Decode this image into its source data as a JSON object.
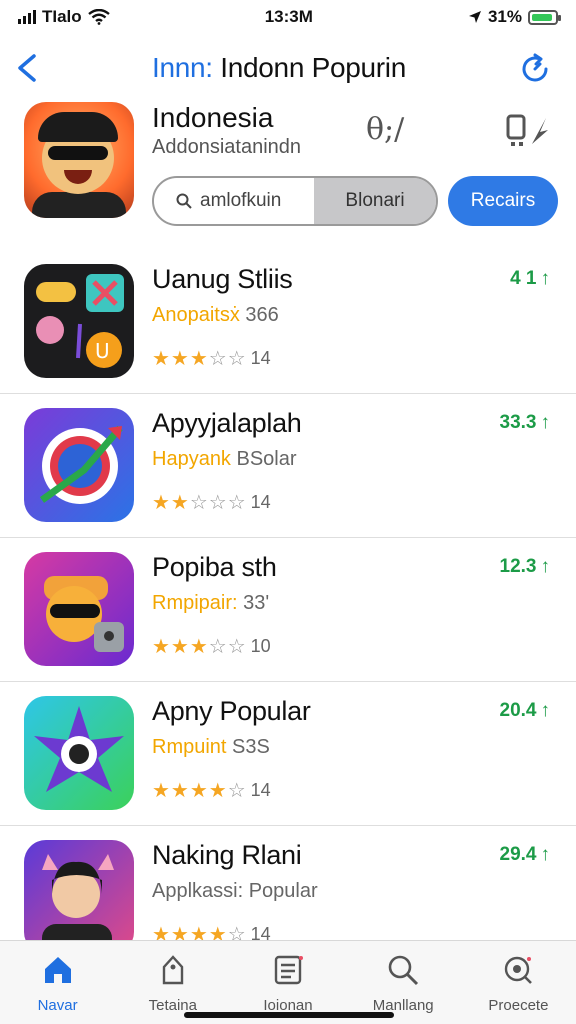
{
  "status_bar": {
    "carrier": "TIalo",
    "time": "13:3M",
    "battery": "31%",
    "battery_level": 0.9
  },
  "nav": {
    "title_accent": "Innn:",
    "title_rest": " Indonn Popurin"
  },
  "header": {
    "name": "Indonesia",
    "subtitle": "Addonsiatanindn",
    "action_a": "θ;/",
    "segment": {
      "search_label": "amlofkuin",
      "other_label": "Blonari"
    },
    "primary_button": "Recairs"
  },
  "apps": [
    {
      "title": "Uanug Stliis",
      "sub_tag": "Anopaitsẋ",
      "sub_rest": " 366",
      "rating": 3,
      "count": "14",
      "metric": "4 1"
    },
    {
      "title": "Apyyjalaplah",
      "sub_tag": "Hapyank",
      "sub_rest": " BSolar",
      "rating": 2,
      "count": "14",
      "metric": "33.3"
    },
    {
      "title": "Popiba sth",
      "sub_tag": "Rmpipair:",
      "sub_rest": " 33'",
      "rating": 3,
      "count": "10",
      "metric": "12.3"
    },
    {
      "title": "Apny Popular",
      "sub_tag": "Rmpuint",
      "sub_rest": " S3S",
      "rating": 4,
      "count": "14",
      "metric": "20.4"
    },
    {
      "title": "Naking Rlani",
      "sub_tag": "",
      "sub_rest": "Applkassi: Popular",
      "rating": 4,
      "count": "14",
      "metric": "29.4"
    }
  ],
  "tabs": [
    {
      "label": "Navar",
      "icon": "home-icon",
      "active": true
    },
    {
      "label": "Tetaina",
      "icon": "tag-icon",
      "active": false
    },
    {
      "label": "Ioionan",
      "icon": "list-icon",
      "active": false
    },
    {
      "label": "Manllang",
      "icon": "search-icon",
      "active": false
    },
    {
      "label": "Proecete",
      "icon": "discover-icon",
      "active": false
    }
  ],
  "colors": {
    "accent": "#1f6fe0",
    "metric_green": "#1c9b47",
    "star": "#f5a623",
    "tag": "#f2a600"
  }
}
